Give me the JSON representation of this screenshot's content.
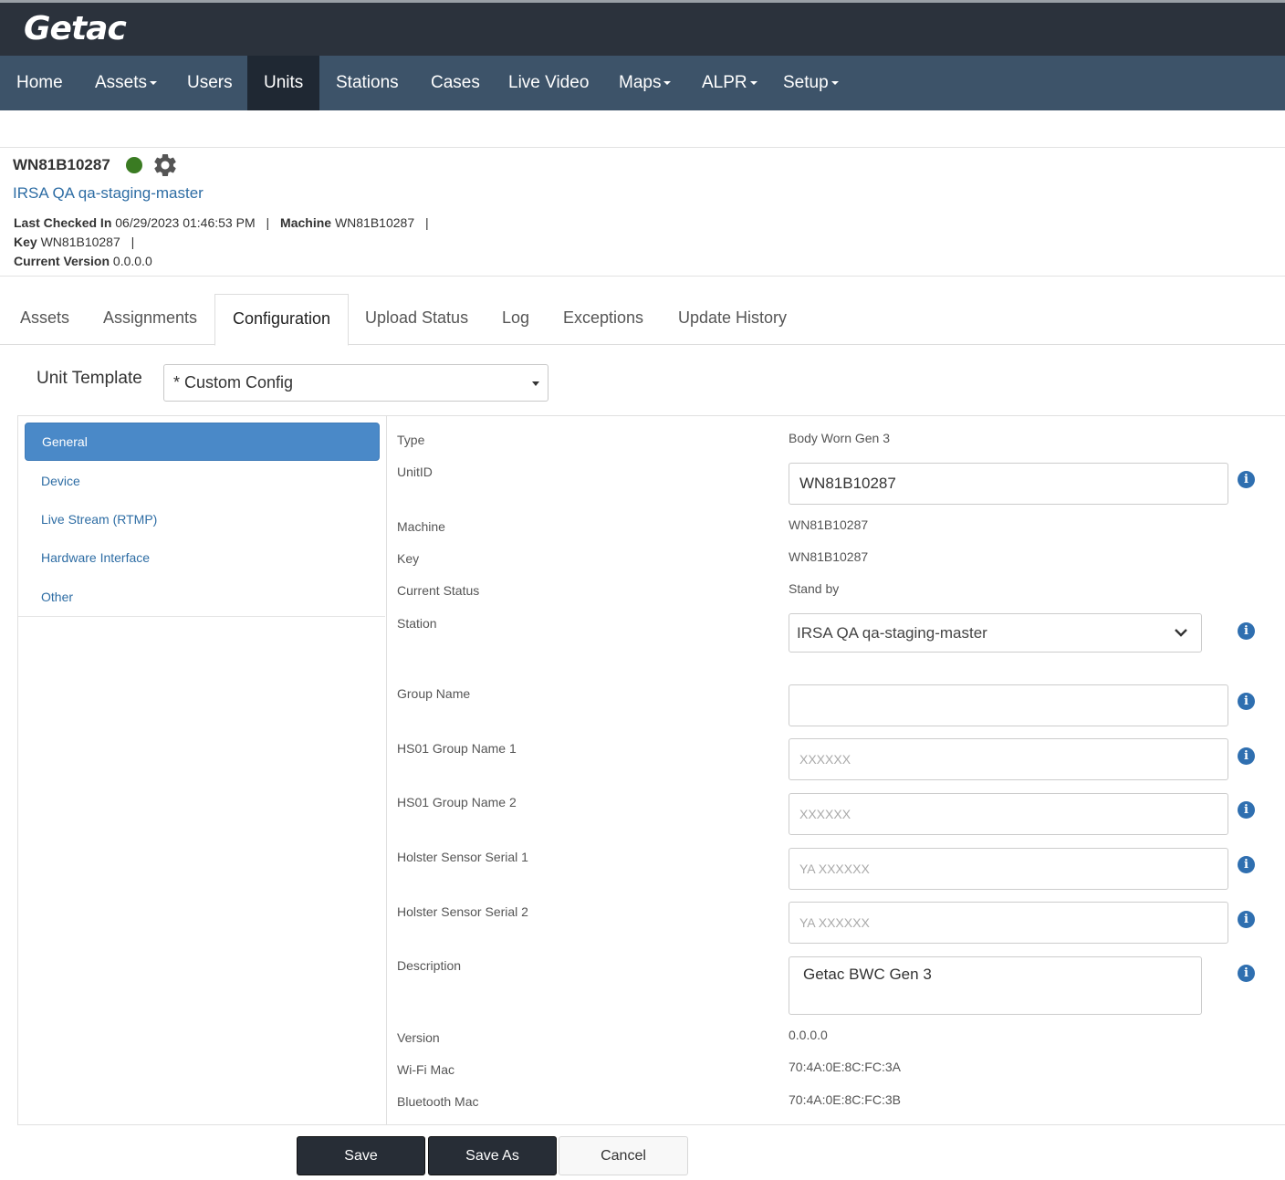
{
  "brand": {
    "logo": "Getac"
  },
  "nav": {
    "home": "Home",
    "assets": "Assets",
    "users": "Users",
    "units": "Units",
    "stations": "Stations",
    "cases": "Cases",
    "live_video": "Live Video",
    "maps": "Maps",
    "alpr": "ALPR",
    "setup": "Setup",
    "active": "Units"
  },
  "unit": {
    "id": "WN81B10287",
    "status_color": "#3a7b22",
    "station_link": "IRSA QA qa-staging-master",
    "last_checked_label": "Last Checked In",
    "last_checked_value": "06/29/2023 01:46:53 PM",
    "machine_label": "Machine",
    "machine_value": "WN81B10287",
    "key_label": "Key",
    "key_value": "WN81B10287",
    "version_label": "Current Version",
    "version_value": "0.0.0.0",
    "separator": "|"
  },
  "tabs": [
    "Assets",
    "Assignments",
    "Configuration",
    "Upload Status",
    "Log",
    "Exceptions",
    "Update History"
  ],
  "active_tab": "Configuration",
  "template": {
    "label": "Unit Template",
    "value": "* Custom Config"
  },
  "sidebar": {
    "items": [
      {
        "label": "General"
      },
      {
        "label": "Device"
      },
      {
        "label": "Live Stream (RTMP)"
      },
      {
        "label": "Hardware Interface"
      },
      {
        "label": "Other"
      }
    ],
    "active": "General"
  },
  "general": {
    "type": {
      "label": "Type",
      "value": "Body Worn Gen 3"
    },
    "unitid": {
      "label": "UnitID",
      "value": "WN81B10287"
    },
    "machine": {
      "label": "Machine",
      "value": "WN81B10287"
    },
    "key": {
      "label": "Key",
      "value": "WN81B10287"
    },
    "current_status": {
      "label": "Current Status",
      "value": "Stand by"
    },
    "station": {
      "label": "Station",
      "value": "IRSA QA qa-staging-master"
    },
    "group_name": {
      "label": "Group Name",
      "value": "",
      "placeholder": ""
    },
    "hs01_group1": {
      "label": "HS01 Group Name 1",
      "placeholder": "XXXXXX"
    },
    "hs01_group2": {
      "label": "HS01 Group Name 2",
      "placeholder": "XXXXXX"
    },
    "holster1": {
      "label": "Holster Sensor Serial 1",
      "placeholder": "YA XXXXXX"
    },
    "holster2": {
      "label": "Holster Sensor Serial 2",
      "placeholder": "YA XXXXXX"
    },
    "description": {
      "label": "Description",
      "value": "Getac BWC Gen 3"
    },
    "version": {
      "label": "Version",
      "value": "0.0.0.0"
    },
    "wifi_mac": {
      "label": "Wi-Fi Mac",
      "value": "70:4A:0E:8C:FC:3A"
    },
    "bt_mac": {
      "label": "Bluetooth Mac",
      "value": "70:4A:0E:8C:FC:3B"
    }
  },
  "info_icon": "info-circle-icon",
  "buttons": {
    "save": "Save",
    "save_as": "Save As",
    "cancel": "Cancel"
  },
  "colors": {
    "navbar": "#3d5369",
    "topbar": "#2b323c",
    "accent": "#4a89c8",
    "link": "#2e6da4"
  }
}
